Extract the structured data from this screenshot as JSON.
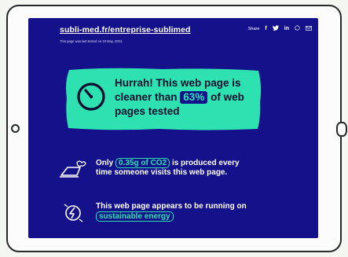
{
  "header": {
    "site": "subli-med.fr/entreprise-sublimed",
    "tested_note": "This page was last tested on 19 May, 2022.",
    "share_label": "Share",
    "share_icons": [
      "facebook-icon",
      "twitter-icon",
      "linkedin-icon",
      "whatsapp-icon",
      "email-icon"
    ]
  },
  "result": {
    "line1": "Hurrah! This web page is",
    "line2_pre": "cleaner than",
    "percent": "63%",
    "line2_post": "of web",
    "line3": "pages tested"
  },
  "co2": {
    "pre": "Only",
    "amount": "0.35g of CO2",
    "post": "is produced every",
    "line2": "time someone visits this web page."
  },
  "energy": {
    "line1": "This web page appears to be running on",
    "highlight": "sustainable energy"
  },
  "colors": {
    "background": "#14118a",
    "accent": "#2de2b0",
    "text": "#ffffff"
  }
}
